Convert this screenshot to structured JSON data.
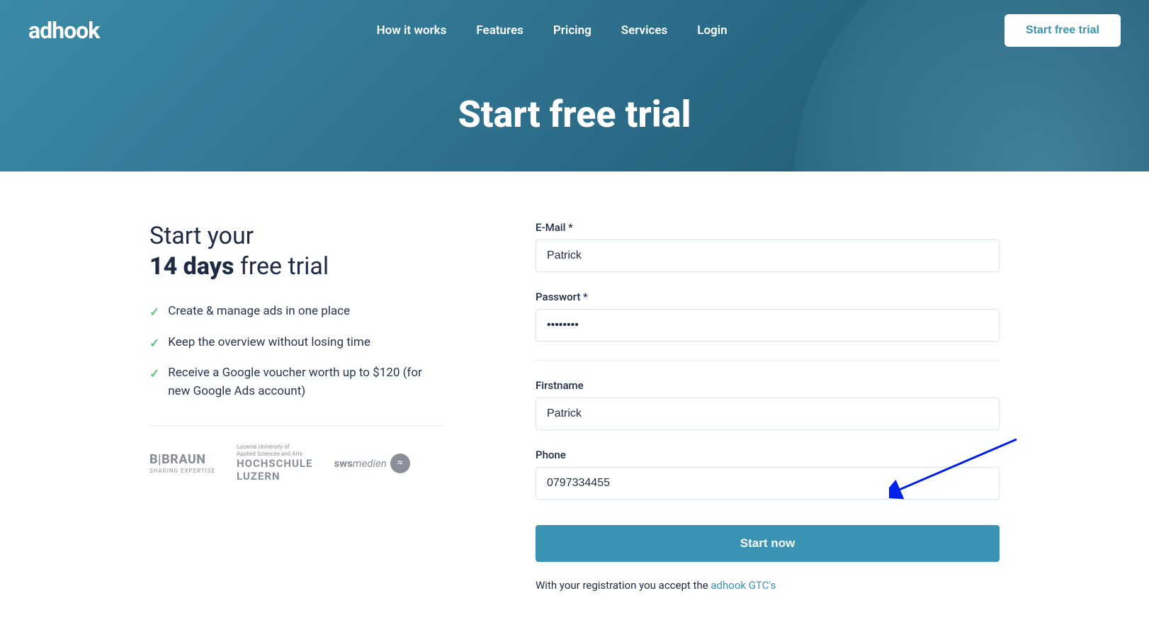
{
  "brand": {
    "name": "adhook"
  },
  "nav": {
    "links": [
      {
        "label": "How it works"
      },
      {
        "label": "Features"
      },
      {
        "label": "Pricing"
      },
      {
        "label": "Services"
      },
      {
        "label": "Login"
      }
    ],
    "cta": "Start free trial"
  },
  "hero": {
    "title": "Start free trial"
  },
  "leftPanel": {
    "heading_line1": "Start your",
    "heading_bold": "14 days",
    "heading_line2_rest": " free trial",
    "benefits": [
      "Create & manage ads in one place",
      "Keep the overview without losing time",
      "Receive a Google voucher worth up to $120 (for new Google Ads account)"
    ],
    "partners": {
      "braun": {
        "main": "B|BRAUN",
        "sub": "SHARING EXPERTISE"
      },
      "hslu": {
        "top": "Lucerne University of\nApplied Sciences and Arts",
        "line1": "HOCHSCHULE",
        "line2": "LUZERN"
      },
      "sws": {
        "bold": "sws",
        "italic": "medien"
      }
    }
  },
  "form": {
    "email": {
      "label": "E-Mail *",
      "value": "Patrick"
    },
    "password": {
      "label": "Passwort *",
      "value": "••••••••"
    },
    "firstname": {
      "label": "Firstname",
      "value": "Patrick"
    },
    "phone": {
      "label": "Phone",
      "value": "0797334455"
    },
    "submit": "Start now",
    "consent_prefix": "With your registration you accept the ",
    "consent_link": "adhook GTC's"
  }
}
